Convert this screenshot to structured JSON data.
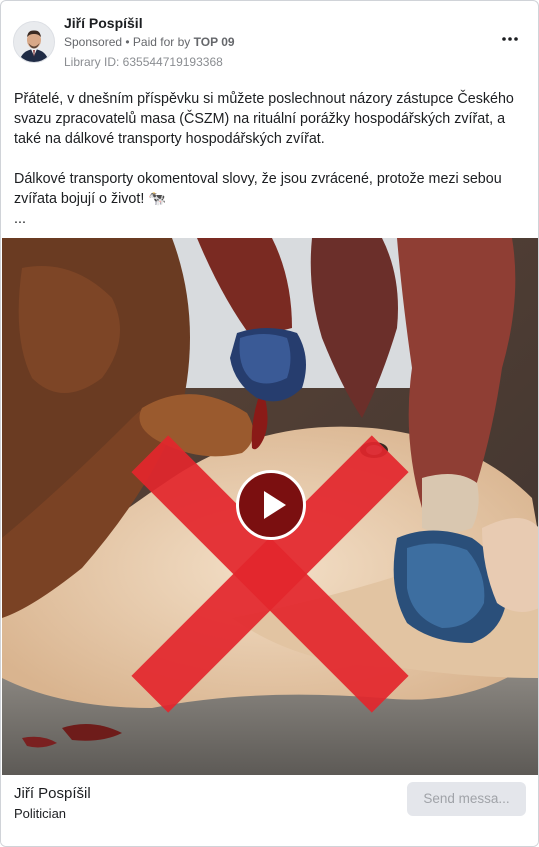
{
  "post": {
    "author": "Jiří Pospíšil",
    "sponsored_label": "Sponsored",
    "separator": " • ",
    "paid_prefix": "Paid for by ",
    "paid_by": "TOP 09",
    "library_id": "Library ID: 635544719193368",
    "more_button": "•••",
    "paragraph1": "Přátelé, v dnešním příspěvku si můžete poslechnout názory zástupce Českého svazu zpracovatelů masa (ČSZM) na rituální porážky hospodářských zvířat, a také na dálkové transporty hospodářských zvířat.",
    "paragraph2": "Dálkové transporty okomentoval slovy, že jsou zvrácené, protože mezi sebou zvířata bojují o život! 🐄",
    "ellipsis": "..."
  },
  "footer": {
    "page_name": "Jiří Pospíšil",
    "page_category": "Politician",
    "send_button": "Send messa..."
  },
  "colors": {
    "cross": "#e3262d",
    "play_button": "#7b0f10",
    "button_bg": "#e4e6eb"
  }
}
